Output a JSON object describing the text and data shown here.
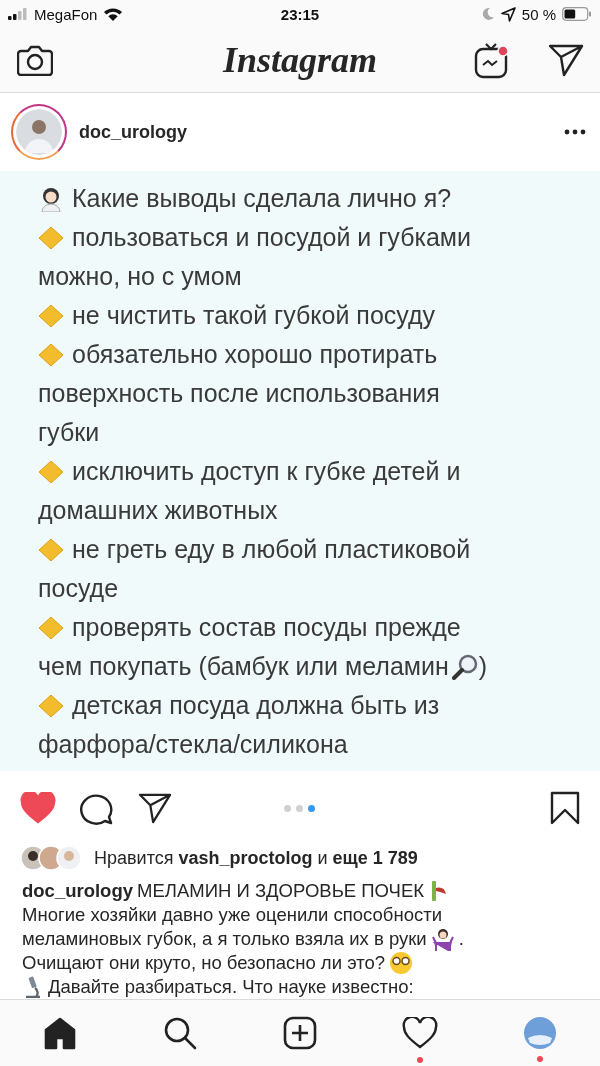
{
  "status_bar": {
    "carrier": "MegaFon",
    "time": "23:15",
    "battery": "50 %"
  },
  "top_bar": {
    "logo": "Instagram",
    "igtv_badge": true
  },
  "post": {
    "username": "doc_urology",
    "slide_items": [
      {
        "kind": "heading",
        "lines": [
          "Какие выводы сделала лично я?"
        ]
      },
      {
        "kind": "bullet",
        "lines": [
          "пользоваться и посудой и губками",
          "можно, но с умом"
        ]
      },
      {
        "kind": "bullet",
        "lines": [
          "не чистить такой губкой посуду"
        ]
      },
      {
        "kind": "bullet",
        "lines": [
          "обязательно хорошо протирать",
          "поверхность после использования",
          "губки"
        ]
      },
      {
        "kind": "bullet",
        "lines": [
          "исключить доступ к губке детей и",
          "домашних животных"
        ]
      },
      {
        "kind": "bullet",
        "lines": [
          "не греть еду в любой пластиковой",
          "посуде"
        ]
      },
      {
        "kind": "bullet",
        "lines": [
          "проверять состав посуды прежде",
          "чем покупать (бамбук или меламин"
        ],
        "tail": ")"
      },
      {
        "kind": "bullet",
        "lines": [
          "детская посуда должна быть из",
          "фарфора/стекла/силикона"
        ]
      }
    ],
    "liked": true,
    "carousel_dots": [
      {
        "selected": false
      },
      {
        "selected": false
      },
      {
        "selected": true
      }
    ],
    "likes_text": "Нравится **vash_proctolog** и **еще 1 789**",
    "caption": {
      "username": "doc_urology",
      "title": "МЕЛАМИН И ЗДОРОВЬЕ ПОЧЕК",
      "lines": [
        {
          "text": "Многие хозяйки давно уже оценили способности"
        },
        {
          "text": "меламиновых губок, а я только взяла их в руки",
          "tail": "."
        },
        {
          "text": "Очищают они круто, но безопасно ли это?"
        },
        {
          "text": "Давайте разбираться. Что науке известно:"
        }
      ]
    }
  },
  "tab_bar": [
    {
      "kind": "home",
      "selected": true,
      "badge": false
    },
    {
      "kind": "search",
      "selected": false,
      "badge": false
    },
    {
      "kind": "add",
      "selected": false,
      "badge": false
    },
    {
      "kind": "activity",
      "selected": false,
      "badge": true
    },
    {
      "kind": "profile",
      "selected": false,
      "badge": true
    }
  ]
}
